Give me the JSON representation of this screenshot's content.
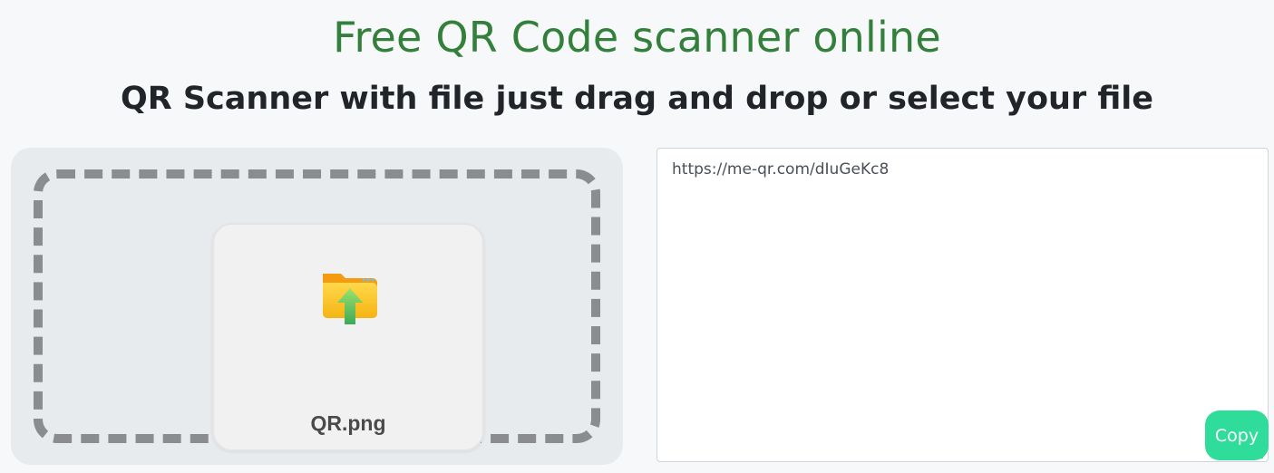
{
  "header": {
    "title": "Free QR Code scanner online",
    "subtitle": "QR Scanner with file just drag and drop or select your file"
  },
  "dropzone": {
    "file_name": "QR.png",
    "icon": "folder-upload-icon"
  },
  "result": {
    "value": "https://me-qr.com/dIuGeKc8",
    "copy_label": "Copy"
  },
  "colors": {
    "title_green": "#33803c",
    "copy_button": "#2fdc9a",
    "dash_border": "#8a8c8f"
  }
}
